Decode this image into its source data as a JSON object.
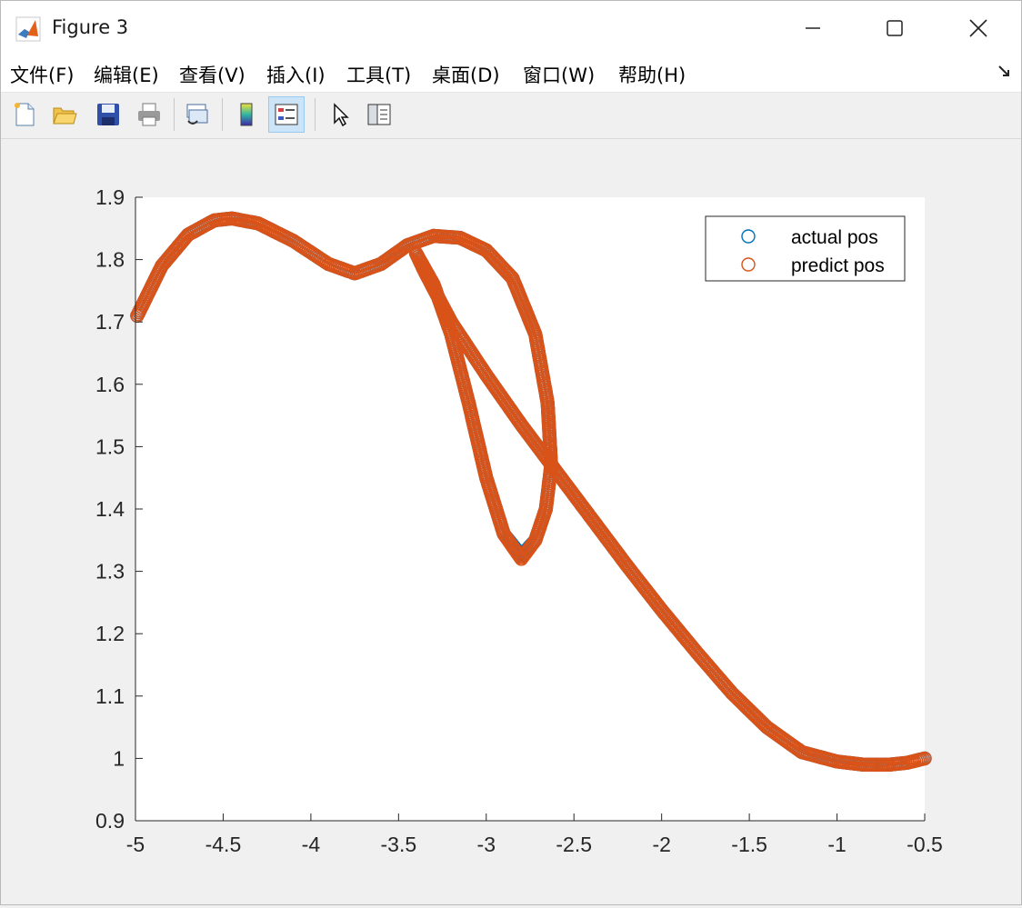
{
  "window": {
    "title": "Figure 3"
  },
  "menu": {
    "items": [
      {
        "label": "文件(F)",
        "key": "F"
      },
      {
        "label": "编辑(E)",
        "key": "E"
      },
      {
        "label": "查看(V)",
        "key": "V"
      },
      {
        "label": "插入(I)",
        "key": "I"
      },
      {
        "label": "工具(T)",
        "key": "T"
      },
      {
        "label": "桌面(D)",
        "key": "D"
      },
      {
        "label": "窗口(W)",
        "key": "W"
      },
      {
        "label": "帮助(H)",
        "key": "H"
      }
    ]
  },
  "toolbar": {
    "icons": [
      "new-figure-icon",
      "open-file-icon",
      "save-icon",
      "print-icon",
      "link-plot-icon",
      "insert-colorbar-icon",
      "insert-legend-icon",
      "edit-plot-icon",
      "property-inspector-icon"
    ],
    "active": "insert-legend-icon"
  },
  "colors": {
    "actual": "#0072bd",
    "predict": "#d95319"
  },
  "chart_data": {
    "type": "scatter",
    "xlim": [
      -5,
      -0.5
    ],
    "ylim": [
      0.9,
      1.9
    ],
    "xticks": [
      "-5",
      "-4.5",
      "-4",
      "-3.5",
      "-3",
      "-2.5",
      "-2",
      "-1.5",
      "-1",
      "-0.5"
    ],
    "yticks": [
      "0.9",
      "1",
      "1.1",
      "1.2",
      "1.3",
      "1.4",
      "1.5",
      "1.6",
      "1.7",
      "1.8",
      "1.9"
    ],
    "marker": "open-circle",
    "legend_position": "top-right",
    "legend": [
      "actual pos",
      "predict pos"
    ],
    "series": [
      {
        "name": "actual pos",
        "x": [
          -4.99,
          -4.85,
          -4.7,
          -4.55,
          -4.45,
          -4.3,
          -4.1,
          -3.9,
          -3.75,
          -3.6,
          -3.45,
          -3.3,
          -3.15,
          -3.0,
          -2.85,
          -2.72,
          -2.65,
          -2.63,
          -2.66,
          -2.72,
          -2.8,
          -2.9,
          -3.0,
          -3.1,
          -3.2,
          -3.3,
          -3.4,
          -3.35,
          -3.2,
          -3.0,
          -2.8,
          -2.6,
          -2.4,
          -2.2,
          -2.0,
          -1.8,
          -1.6,
          -1.4,
          -1.2,
          -1.0,
          -0.85,
          -0.7,
          -0.6,
          -0.5
        ],
        "y": [
          1.71,
          1.79,
          1.84,
          1.863,
          1.866,
          1.858,
          1.83,
          1.793,
          1.778,
          1.793,
          1.823,
          1.838,
          1.835,
          1.815,
          1.77,
          1.68,
          1.57,
          1.47,
          1.4,
          1.35,
          1.325,
          1.36,
          1.45,
          1.57,
          1.68,
          1.76,
          1.81,
          1.78,
          1.7,
          1.615,
          1.535,
          1.46,
          1.385,
          1.31,
          1.238,
          1.17,
          1.105,
          1.05,
          1.01,
          0.995,
          0.99,
          0.99,
          0.993,
          1.0
        ]
      },
      {
        "name": "predict pos",
        "x": [
          -4.99,
          -4.85,
          -4.7,
          -4.55,
          -4.45,
          -4.3,
          -4.1,
          -3.9,
          -3.75,
          -3.6,
          -3.45,
          -3.3,
          -3.15,
          -3.0,
          -2.85,
          -2.72,
          -2.65,
          -2.63,
          -2.66,
          -2.72,
          -2.8,
          -2.9,
          -3.0,
          -3.1,
          -3.2,
          -3.3,
          -3.4,
          -3.35,
          -3.2,
          -3.0,
          -2.8,
          -2.6,
          -2.4,
          -2.2,
          -2.0,
          -1.8,
          -1.6,
          -1.4,
          -1.2,
          -1.0,
          -0.85,
          -0.7,
          -0.6,
          -0.5
        ],
        "y": [
          1.71,
          1.79,
          1.84,
          1.863,
          1.866,
          1.858,
          1.83,
          1.793,
          1.778,
          1.793,
          1.823,
          1.838,
          1.835,
          1.815,
          1.77,
          1.68,
          1.57,
          1.47,
          1.4,
          1.35,
          1.32,
          1.36,
          1.45,
          1.57,
          1.68,
          1.76,
          1.81,
          1.78,
          1.7,
          1.615,
          1.535,
          1.46,
          1.385,
          1.31,
          1.238,
          1.17,
          1.105,
          1.05,
          1.01,
          0.995,
          0.99,
          0.99,
          0.993,
          1.0
        ]
      }
    ]
  }
}
